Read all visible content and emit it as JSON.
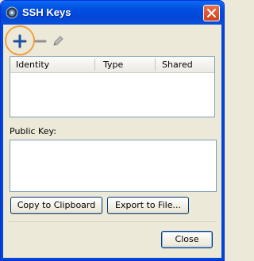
{
  "window": {
    "title": "SSH Keys",
    "icons": {
      "app": "ssh-app-icon",
      "close": "close-icon"
    }
  },
  "toolbar": {
    "add_icon": "plus-icon",
    "remove_icon": "minus-icon",
    "edit_icon": "pencil-icon",
    "highlight_color": "#f0a040"
  },
  "keys_table": {
    "columns": [
      "Identity",
      "Type",
      "Shared"
    ],
    "rows": []
  },
  "public_key": {
    "label": "Public Key:",
    "value": ""
  },
  "buttons": {
    "copy": "Copy to Clipboard",
    "export": "Export to File...",
    "close": "Close"
  },
  "colors": {
    "titlebar": "#0050e0",
    "close_button": "#d2401c",
    "dialog_bg": "#ece9d8",
    "add_icon": "#1f4fa0"
  }
}
